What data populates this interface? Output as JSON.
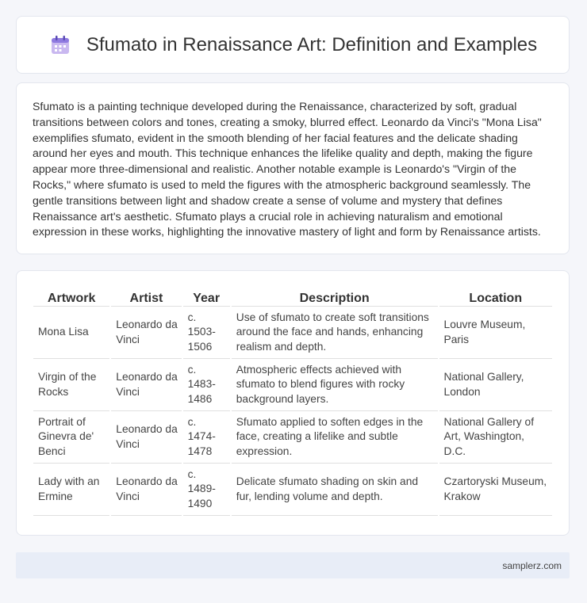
{
  "header": {
    "title": "Sfumato in Renaissance Art: Definition and Examples",
    "icon": "calendar-icon"
  },
  "intro": {
    "text": "Sfumato is a painting technique developed during the Renaissance, characterized by soft, gradual transitions between colors and tones, creating a smoky, blurred effect. Leonardo da Vinci's \"Mona Lisa\" exemplifies sfumato, evident in the smooth blending of her facial features and the delicate shading around her eyes and mouth. This technique enhances the lifelike quality and depth, making the figure appear more three-dimensional and realistic. Another notable example is Leonardo's \"Virgin of the Rocks,\" where sfumato is used to meld the figures with the atmospheric background seamlessly. The gentle transitions between light and shadow create a sense of volume and mystery that defines Renaissance art's aesthetic. Sfumato plays a crucial role in achieving naturalism and emotional expression in these works, highlighting the innovative mastery of light and form by Renaissance artists."
  },
  "table": {
    "headers": [
      "Artwork",
      "Artist",
      "Year",
      "Description",
      "Location"
    ],
    "rows": [
      [
        "Mona Lisa",
        "Leonardo da Vinci",
        "c. 1503-1506",
        "Use of sfumato to create soft transitions around the face and hands, enhancing realism and depth.",
        "Louvre Museum, Paris"
      ],
      [
        "Virgin of the Rocks",
        "Leonardo da Vinci",
        "c. 1483-1486",
        "Atmospheric effects achieved with sfumato to blend figures with rocky background layers.",
        "National Gallery, London"
      ],
      [
        "Portrait of Ginevra de' Benci",
        "Leonardo da Vinci",
        "c. 1474-1478",
        "Sfumato applied to soften edges in the face, creating a lifelike and subtle expression.",
        "National Gallery of Art, Washington, D.C."
      ],
      [
        "Lady with an Ermine",
        "Leonardo da Vinci",
        "c. 1489-1490",
        "Delicate sfumato shading on skin and fur, lending volume and depth.",
        "Czartoryski Museum, Krakow"
      ]
    ]
  },
  "footer": {
    "text": "samplerz.com"
  }
}
